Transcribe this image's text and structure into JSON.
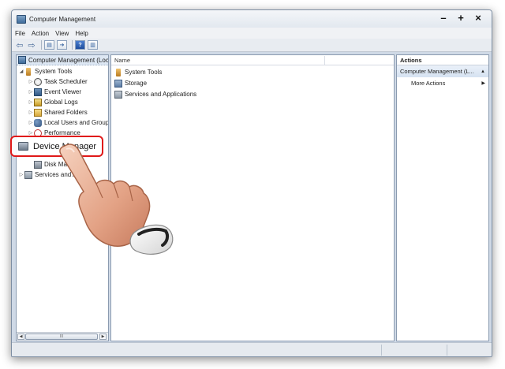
{
  "window": {
    "title": "Computer Management",
    "controls": {
      "minimize": "–",
      "maximize": "+",
      "close": "×"
    }
  },
  "menu": [
    "File",
    "Action",
    "View",
    "Help"
  ],
  "tree": {
    "root": "Computer Management (Loca",
    "items": [
      {
        "label": "System Tools",
        "icon": "tools-icon"
      },
      {
        "label": "Task Scheduler",
        "icon": "clock-icon"
      },
      {
        "label": "Event Viewer",
        "icon": "event-viewer-icon"
      },
      {
        "label": "Global Logs",
        "icon": "logs-icon"
      },
      {
        "label": "Shared Folders",
        "icon": "folder-icon"
      },
      {
        "label": "Local Users and Groups",
        "icon": "users-icon"
      },
      {
        "label": "Performance",
        "icon": "performance-icon"
      },
      {
        "label": "Disk Man",
        "icon": "disk-icon"
      },
      {
        "label": "Services and Ap",
        "icon": "services-icon"
      }
    ],
    "highlighted": "Device Manager"
  },
  "list": {
    "column_name": "Name",
    "items": [
      "System Tools",
      "Storage",
      "Services and Applications"
    ]
  },
  "actions": {
    "title": "Actions",
    "section": "Computer Management (L...",
    "more": "More Actions"
  },
  "scrollbar": {
    "thumb_grip": "III"
  },
  "colors": {
    "highlight_border": "#e01818",
    "accent": "#3e6a98"
  }
}
